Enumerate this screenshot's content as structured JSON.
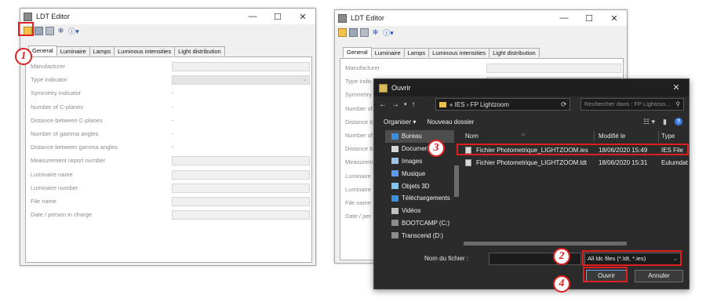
{
  "left_window": {
    "title": "LDT Editor",
    "controls": [
      "—",
      "☐",
      "✕"
    ],
    "toolbar": {
      "info_label": "ⓘ▾"
    },
    "tabs": [
      "General",
      "Luminaire",
      "Lamps",
      "Luminous intensities",
      "Light distribution"
    ],
    "fields": [
      {
        "label": "Manufacturer",
        "kind": "field"
      },
      {
        "label": "Type indicator",
        "kind": "combo"
      },
      {
        "label": "Symmetry indicator",
        "kind": "value",
        "value": "-"
      },
      {
        "label": "Number of C-planes",
        "kind": "value",
        "value": "-"
      },
      {
        "label": "Distance between C-planes",
        "kind": "value",
        "value": "-"
      },
      {
        "label": "Number of gamma angles",
        "kind": "value",
        "value": "-"
      },
      {
        "label": "Distance between gamma angles",
        "kind": "value",
        "value": "-"
      },
      {
        "label": "Measurement report number",
        "kind": "field"
      },
      {
        "label": "Luminaire name",
        "kind": "field"
      },
      {
        "label": "Luminaire number",
        "kind": "field"
      },
      {
        "label": "File name",
        "kind": "field"
      },
      {
        "label": "Date / person in charge",
        "kind": "field"
      }
    ]
  },
  "right_window": {
    "title": "LDT Editor",
    "tabs": [
      "General",
      "Luminaire",
      "Lamps",
      "Luminous intensities",
      "Light distribution"
    ],
    "labels_truncated": [
      "Manufacturer",
      "Type indic",
      "Symmetry i",
      "Number of",
      "Distance b",
      "Number of",
      "Distance b",
      "Measurem",
      "Luminaire",
      "Luminaire",
      "File name",
      "Date / per"
    ]
  },
  "dialog": {
    "title": "Ouvrir",
    "address": "« IES › FP Lightzoom",
    "search_placeholder": "Rechercher dans : FP Lightzoo...",
    "commands": {
      "organize": "Organiser ▾",
      "new_folder": "Nouveau dossier"
    },
    "sidebar": [
      {
        "label": "Bureau",
        "color": "#3d8de0"
      },
      {
        "label": "Documents",
        "color": "#d6d6d6"
      },
      {
        "label": "Images",
        "color": "#9bc4e8"
      },
      {
        "label": "Musique",
        "color": "#5b9cf0"
      },
      {
        "label": "Objets 3D",
        "color": "#7fc6f0"
      },
      {
        "label": "Téléchargements",
        "color": "#3d8de0"
      },
      {
        "label": "Vidéos",
        "color": "#c0c0c0"
      },
      {
        "label": "BOOTCAMP (C:)",
        "color": "#8c8c8c"
      },
      {
        "label": "Transcend (D:)",
        "color": "#8c8c8c"
      }
    ],
    "columns": {
      "name": "Nom",
      "modified": "Modifié le",
      "type": "Type"
    },
    "files": [
      {
        "name": "Fichier Photometrique_LIGHTZOOM.ies",
        "modified": "18/06/2020 15:49",
        "type": "IES File"
      },
      {
        "name": "Fichier Photometrique_LIGHTZOOM.ldt",
        "modified": "18/06/2020 15:31",
        "type": "Eulumdat"
      }
    ],
    "filename_label": "Nom du fichier :",
    "filename_value": "",
    "filetype": "All ldc files (*.ldt, *.ies)",
    "open_label": "Ouvrir",
    "cancel_label": "Annuler"
  },
  "callouts": [
    "1",
    "2",
    "3",
    "4"
  ],
  "accent_red": "#e02020"
}
